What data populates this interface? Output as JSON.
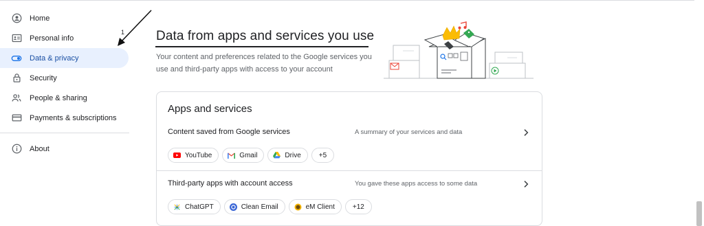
{
  "sidebar": {
    "items": [
      {
        "label": "Home",
        "icon": "person-circle-icon"
      },
      {
        "label": "Personal info",
        "icon": "id-card-icon"
      },
      {
        "label": "Data & privacy",
        "icon": "toggle-icon",
        "active": true
      },
      {
        "label": "Security",
        "icon": "lock-icon"
      },
      {
        "label": "People & sharing",
        "icon": "people-icon"
      },
      {
        "label": "Payments & subscriptions",
        "icon": "credit-card-icon"
      }
    ],
    "about": {
      "label": "About",
      "icon": "info-icon"
    }
  },
  "annotation": {
    "number": "1"
  },
  "hero": {
    "title": "Data from apps and services you use",
    "description": "Your content and preferences related to the Google services you use and third-party apps with access to your account"
  },
  "card": {
    "title": "Apps and services",
    "rows": [
      {
        "label": "Content saved from Google services",
        "description": "A summary of your services and data",
        "chips": [
          {
            "label": "YouTube",
            "icon": "youtube-icon"
          },
          {
            "label": "Gmail",
            "icon": "gmail-icon"
          },
          {
            "label": "Drive",
            "icon": "drive-icon"
          },
          {
            "label": "+5"
          }
        ]
      },
      {
        "label": "Third-party apps with account access",
        "description": "You gave these apps access to some data",
        "chips": [
          {
            "label": "ChatGPT",
            "icon": "chatgpt-icon"
          },
          {
            "label": "Clean Email",
            "icon": "clean-email-icon"
          },
          {
            "label": "eM Client",
            "icon": "em-client-icon"
          },
          {
            "label": "+12"
          }
        ]
      }
    ]
  },
  "colors": {
    "accent": "#1a73e8",
    "active_bg": "#e8f0fe",
    "active_text": "#1a4fa3",
    "text": "#202124",
    "muted": "#5f6368",
    "border": "#dadce0"
  }
}
